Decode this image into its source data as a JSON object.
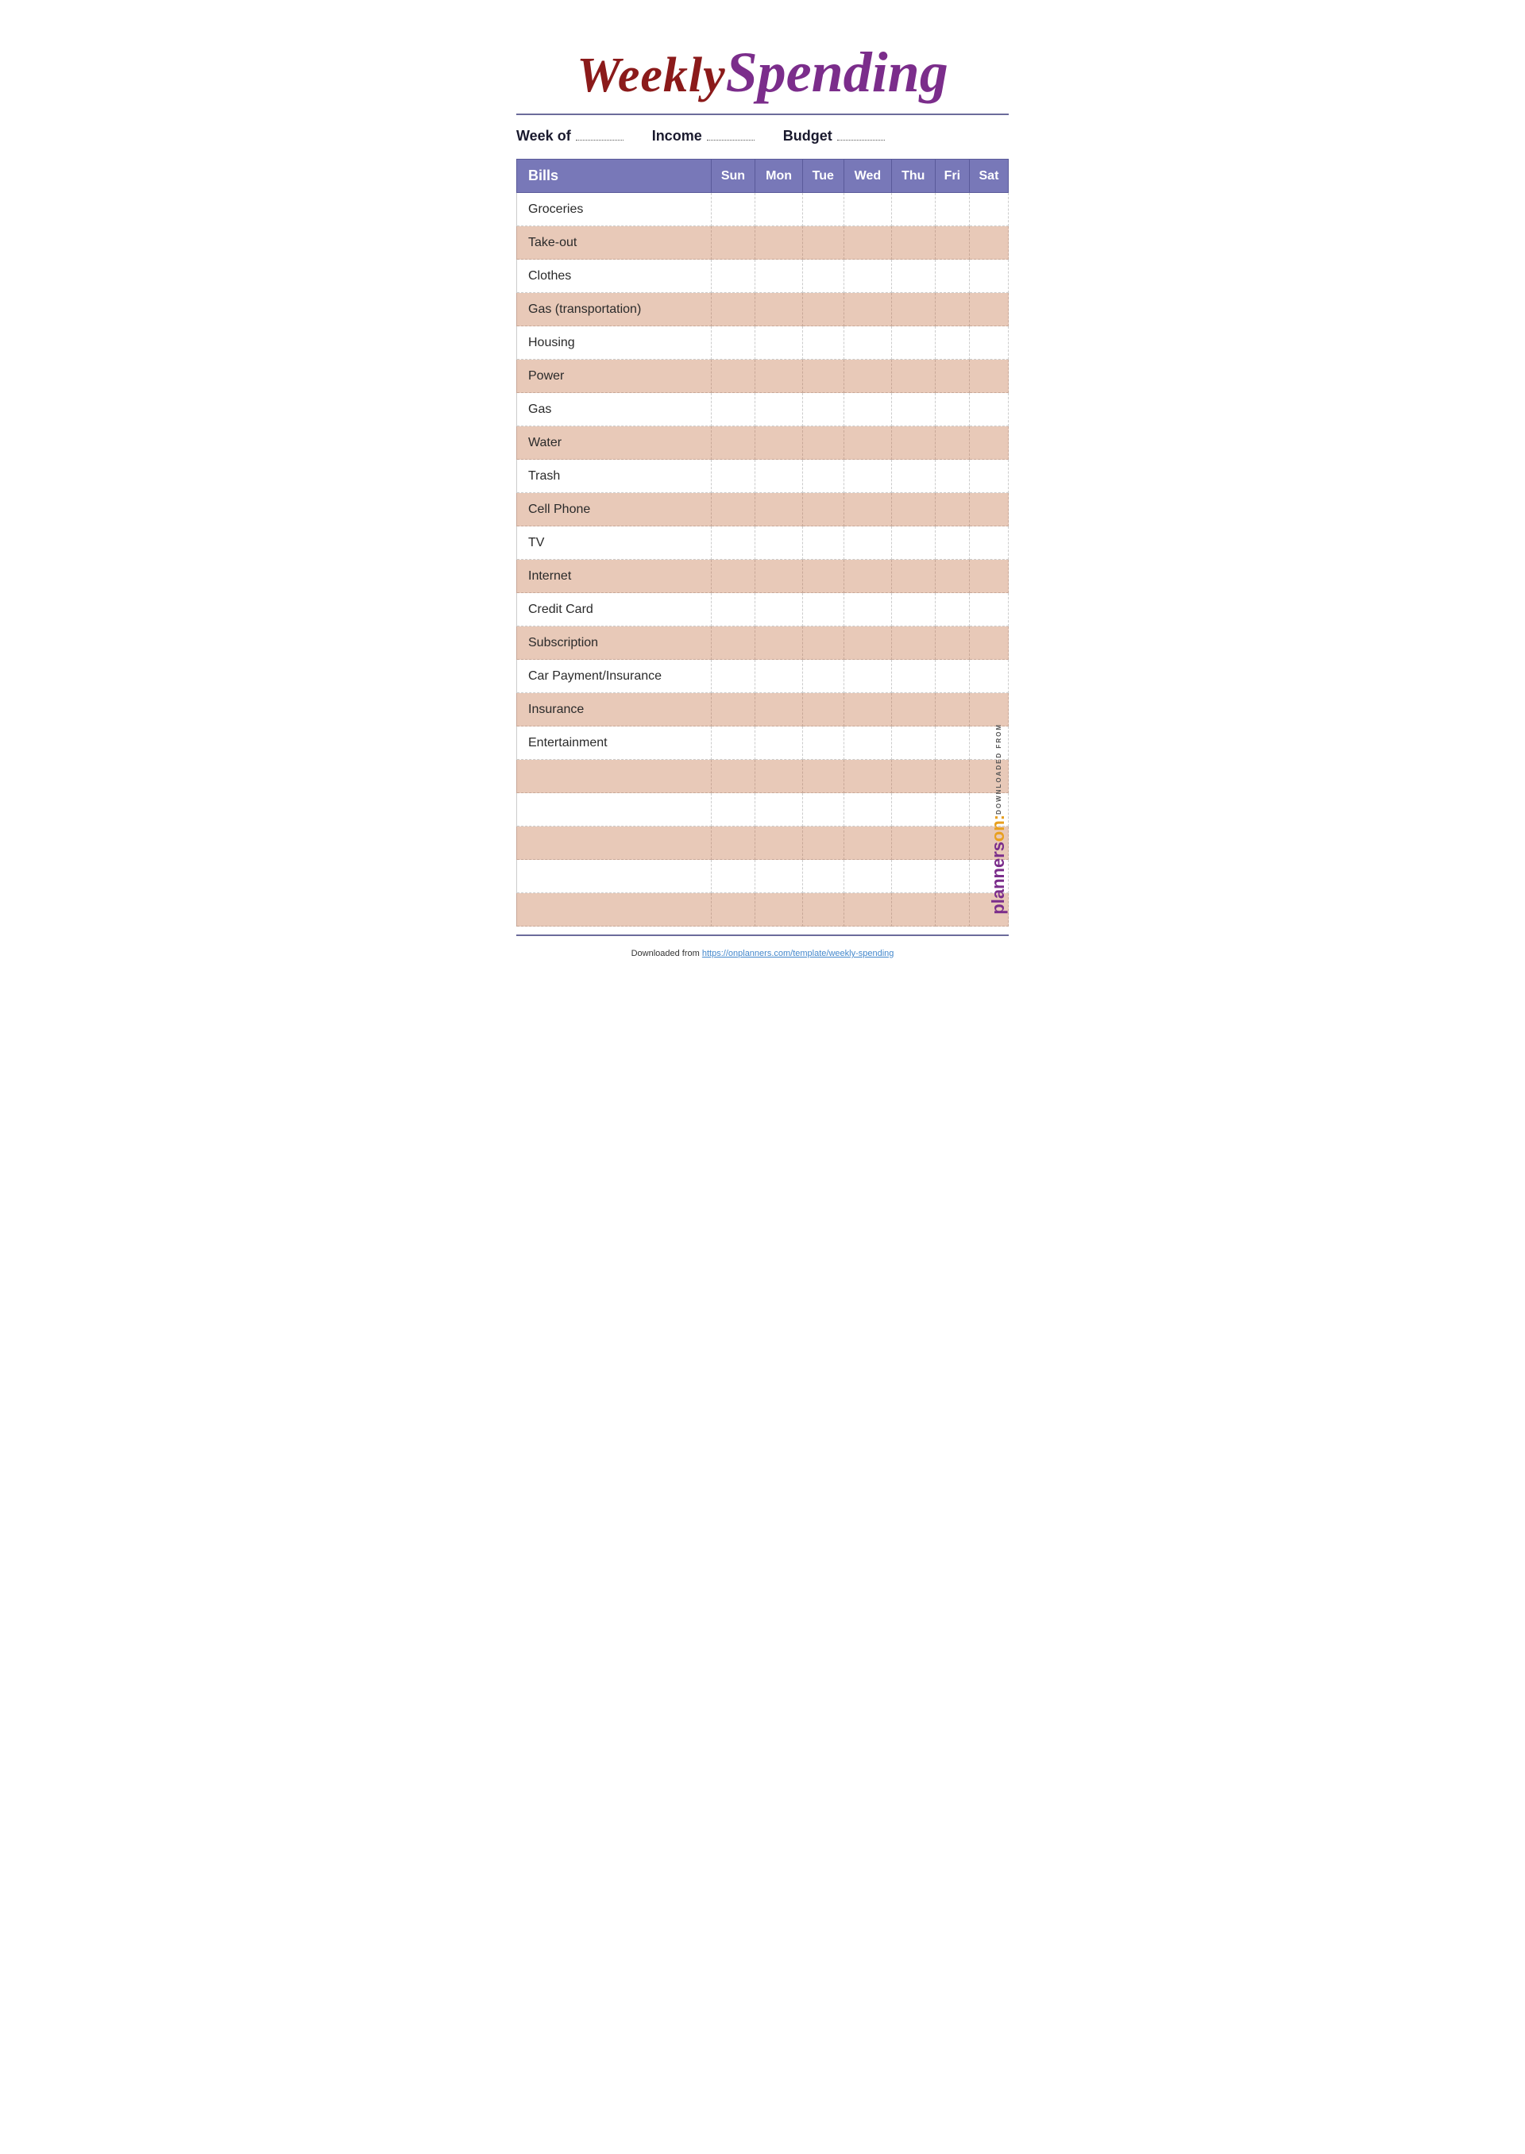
{
  "title": {
    "weekly": "Weekly",
    "spending": "Spending"
  },
  "meta": {
    "week_of_label": "Week of",
    "income_label": "Income",
    "budget_label": "Budget"
  },
  "table": {
    "headers": [
      "Bills",
      "Sun",
      "Mon",
      "Tue",
      "Wed",
      "Thu",
      "Fri",
      "Sat"
    ],
    "rows": [
      {
        "label": "Groceries",
        "shade": "white"
      },
      {
        "label": "Take-out",
        "shade": "tan"
      },
      {
        "label": "Clothes",
        "shade": "white"
      },
      {
        "label": "Gas (transportation)",
        "shade": "tan"
      },
      {
        "label": "Housing",
        "shade": "white"
      },
      {
        "label": "Power",
        "shade": "tan"
      },
      {
        "label": "Gas",
        "shade": "white"
      },
      {
        "label": "Water",
        "shade": "tan"
      },
      {
        "label": "Trash",
        "shade": "white"
      },
      {
        "label": "Cell Phone",
        "shade": "tan"
      },
      {
        "label": "TV",
        "shade": "white"
      },
      {
        "label": "Internet",
        "shade": "tan"
      },
      {
        "label": "Credit Card",
        "shade": "white"
      },
      {
        "label": "Subscription",
        "shade": "tan"
      },
      {
        "label": "Car Payment/Insurance",
        "shade": "white"
      },
      {
        "label": "Insurance",
        "shade": "tan"
      },
      {
        "label": "Entertainment",
        "shade": "white"
      },
      {
        "label": "",
        "shade": "tan"
      },
      {
        "label": "",
        "shade": "white"
      },
      {
        "label": "",
        "shade": "tan"
      },
      {
        "label": "",
        "shade": "white"
      },
      {
        "label": "",
        "shade": "tan"
      }
    ]
  },
  "watermark": {
    "downloaded_from": "DOWNLOADED FROM",
    "on": "on:",
    "planners": "planners"
  },
  "footer": {
    "text": "Downloaded from",
    "url": "https://onplanners.com/template/weekly-spending",
    "url_label": "https://onplanners.com/template/weekly-spending"
  }
}
